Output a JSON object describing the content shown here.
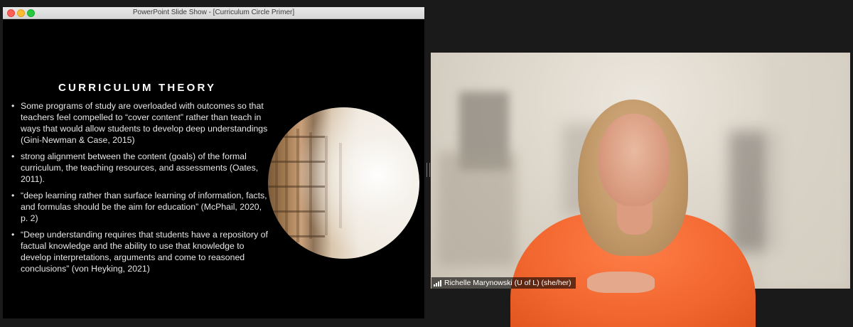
{
  "window": {
    "title": "PowerPoint Slide Show - [Curriculum Circle Primer]"
  },
  "slide": {
    "heading": "CURRICULUM THEORY",
    "bullets": [
      "Some programs of study are overloaded with outcomes so that teachers feel compelled to “cover content” rather than teach in ways that would allow students to develop deep understandings (Gini-Newman & Case, 2015)",
      "strong alignment between the content (goals) of the formal curriculum, the teaching resources, and assessments (Oates, 2011).",
      "“deep learning rather than surface learning of information, facts, and formulas should be the aim for education” (McPhail, 2020, p. 2)",
      "“Deep understanding requires that students have a repository of factual knowledge and the ability to use that knowledge to develop interpretations, arguments and come to reasoned conclusions” (von Heyking, 2021)"
    ]
  },
  "video": {
    "participant_name": "Richelle Marynowski (U of L) (she/her)",
    "signal_icon": "signal-strength-icon"
  },
  "colors": {
    "slide_background": "#000000",
    "meeting_background": "#1a1a1a",
    "shirt": "#f2662f"
  }
}
